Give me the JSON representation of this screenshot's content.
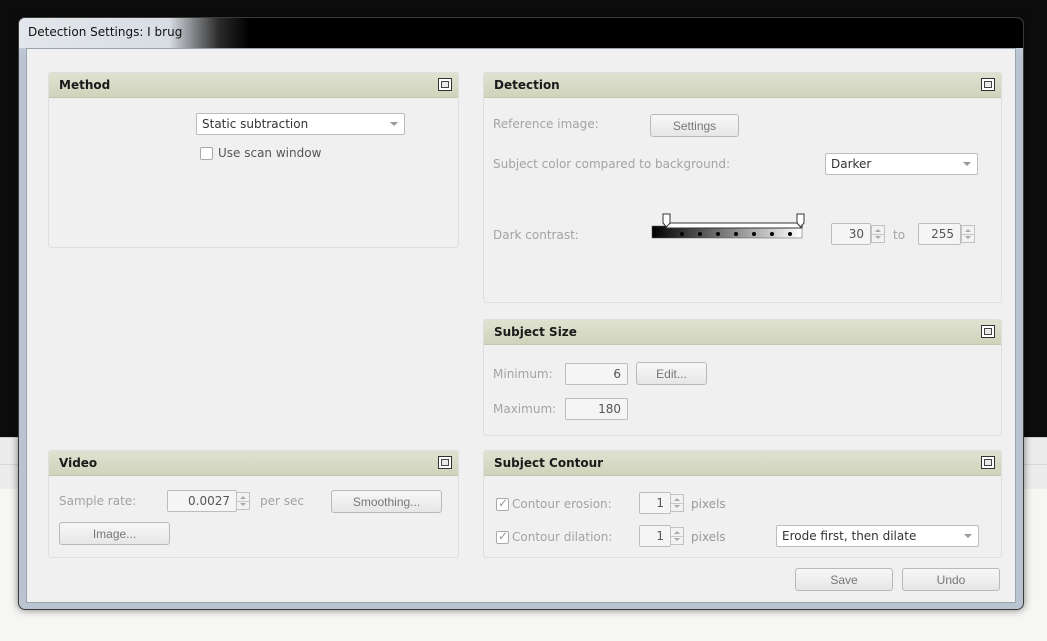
{
  "window": {
    "title": "Detection Settings: I brug"
  },
  "method": {
    "title": "Method",
    "method_select": "Static subtraction",
    "use_scan_window": "Use scan window"
  },
  "detection": {
    "title": "Detection",
    "reference_label": "Reference image:",
    "settings_button": "Settings",
    "color_label": "Subject color compared to background:",
    "color_select": "Darker",
    "contrast_label": "Dark contrast:",
    "contrast_min": "30",
    "to_label": "to",
    "contrast_max": "255"
  },
  "subject_size": {
    "title": "Subject Size",
    "min_label": "Minimum:",
    "min_value": "6",
    "edit_button": "Edit...",
    "max_label": "Maximum:",
    "max_value": "180"
  },
  "video": {
    "title": "Video",
    "sample_rate_label": "Sample rate:",
    "sample_rate_value": "0.0027",
    "per_sec": "per sec",
    "smoothing_button": "Smoothing...",
    "image_button": "Image..."
  },
  "contour": {
    "title": "Subject Contour",
    "erosion_label": "Contour erosion:",
    "erosion_value": "1",
    "erosion_unit": "pixels",
    "dilation_label": "Contour dilation:",
    "dilation_value": "1",
    "dilation_unit": "pixels",
    "order_select": "Erode first, then dilate"
  },
  "footer": {
    "save": "Save",
    "undo": "Undo"
  }
}
